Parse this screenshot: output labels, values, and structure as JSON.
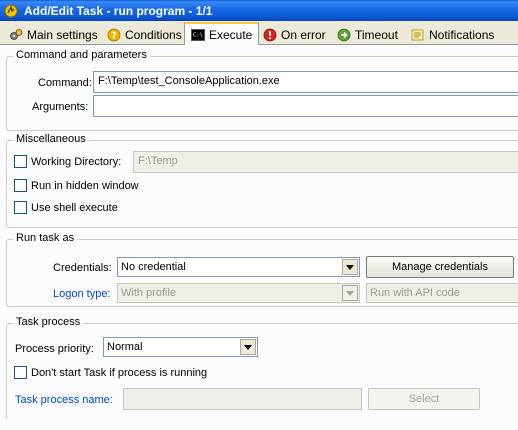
{
  "window": {
    "title": "Add/Edit Task - run program - 1/1"
  },
  "tabs": [
    {
      "label": "Main settings",
      "icon": "gears-icon"
    },
    {
      "label": "Conditions",
      "icon": "question-icon"
    },
    {
      "label": "Execute",
      "icon": "console-icon",
      "active": true
    },
    {
      "label": "On error",
      "icon": "error-icon"
    },
    {
      "label": "Timeout",
      "icon": "timeout-icon"
    },
    {
      "label": "Notifications",
      "icon": "notifications-icon"
    }
  ],
  "command_group": {
    "title": "Command and parameters",
    "command_label": "Command:",
    "command_value": "F:\\Temp\\test_ConsoleApplication.exe",
    "arguments_label": "Arguments:",
    "arguments_value": ""
  },
  "misc_group": {
    "title": "Miscellaneous",
    "working_dir_label": "Working Directory:",
    "working_dir_value": "F:\\Temp",
    "hidden_window_label": "Run in hidden window",
    "shell_execute_label": "Use shell execute"
  },
  "run_as_group": {
    "title": "Run task as",
    "credentials_label": "Credentials:",
    "credentials_value": "No credential",
    "manage_button": "Manage credentials",
    "logon_type_label": "Logon type:",
    "logon_type_value": "With profile",
    "run_with_value": "Run with API code"
  },
  "process_group": {
    "title": "Task process",
    "priority_label": "Process priority:",
    "priority_value": "Normal",
    "dont_start_label": "Don't start Task if process is running",
    "process_name_label": "Task process name:",
    "process_name_value": "",
    "select_button": "Select"
  },
  "colors": {
    "title_bar": "#0a5fd6",
    "tab_highlight": "#ffc83c",
    "link_label": "#0046d5"
  }
}
